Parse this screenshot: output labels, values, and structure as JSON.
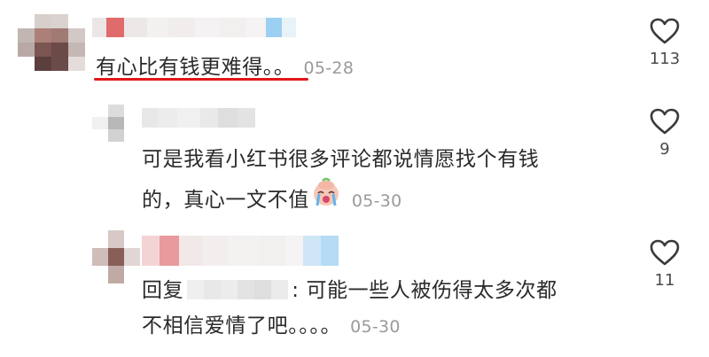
{
  "comments": [
    {
      "text": "有心比有钱更难得。。",
      "date": "05-28",
      "likes": "113"
    },
    {
      "line1": "可是我看小红书很多评论都说情愿找个有钱",
      "line2": "的，真心一文不值",
      "emoji_icon": "crying-face-emoji",
      "date": "05-30",
      "likes": "9"
    },
    {
      "prefix": "回复",
      "colon_text": ": 可能一些人被伤得太多次都",
      "line2": "不相信爱情了吧。。。。",
      "date": "05-30",
      "likes": "11"
    }
  ],
  "colors": {
    "underline": "#e2161b",
    "heart_outline": "#3a3a3a",
    "date_gray": "#9a9a9a"
  }
}
